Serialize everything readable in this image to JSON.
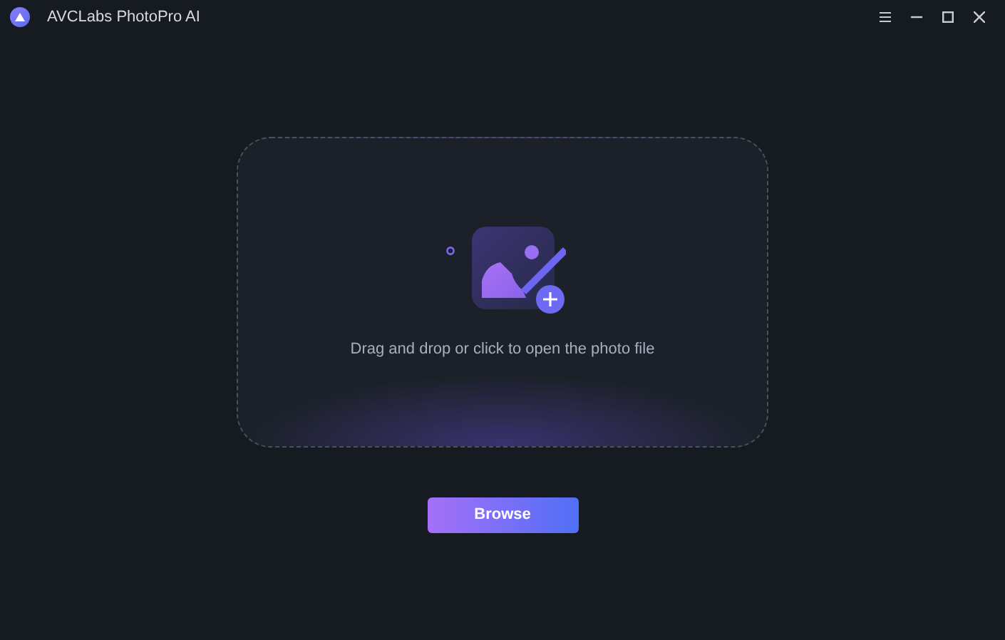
{
  "window": {
    "title": "AVCLabs PhotoPro AI"
  },
  "drop_zone": {
    "prompt": "Drag and drop or click to open the photo file"
  },
  "browse_button": {
    "label": "Browse"
  }
}
